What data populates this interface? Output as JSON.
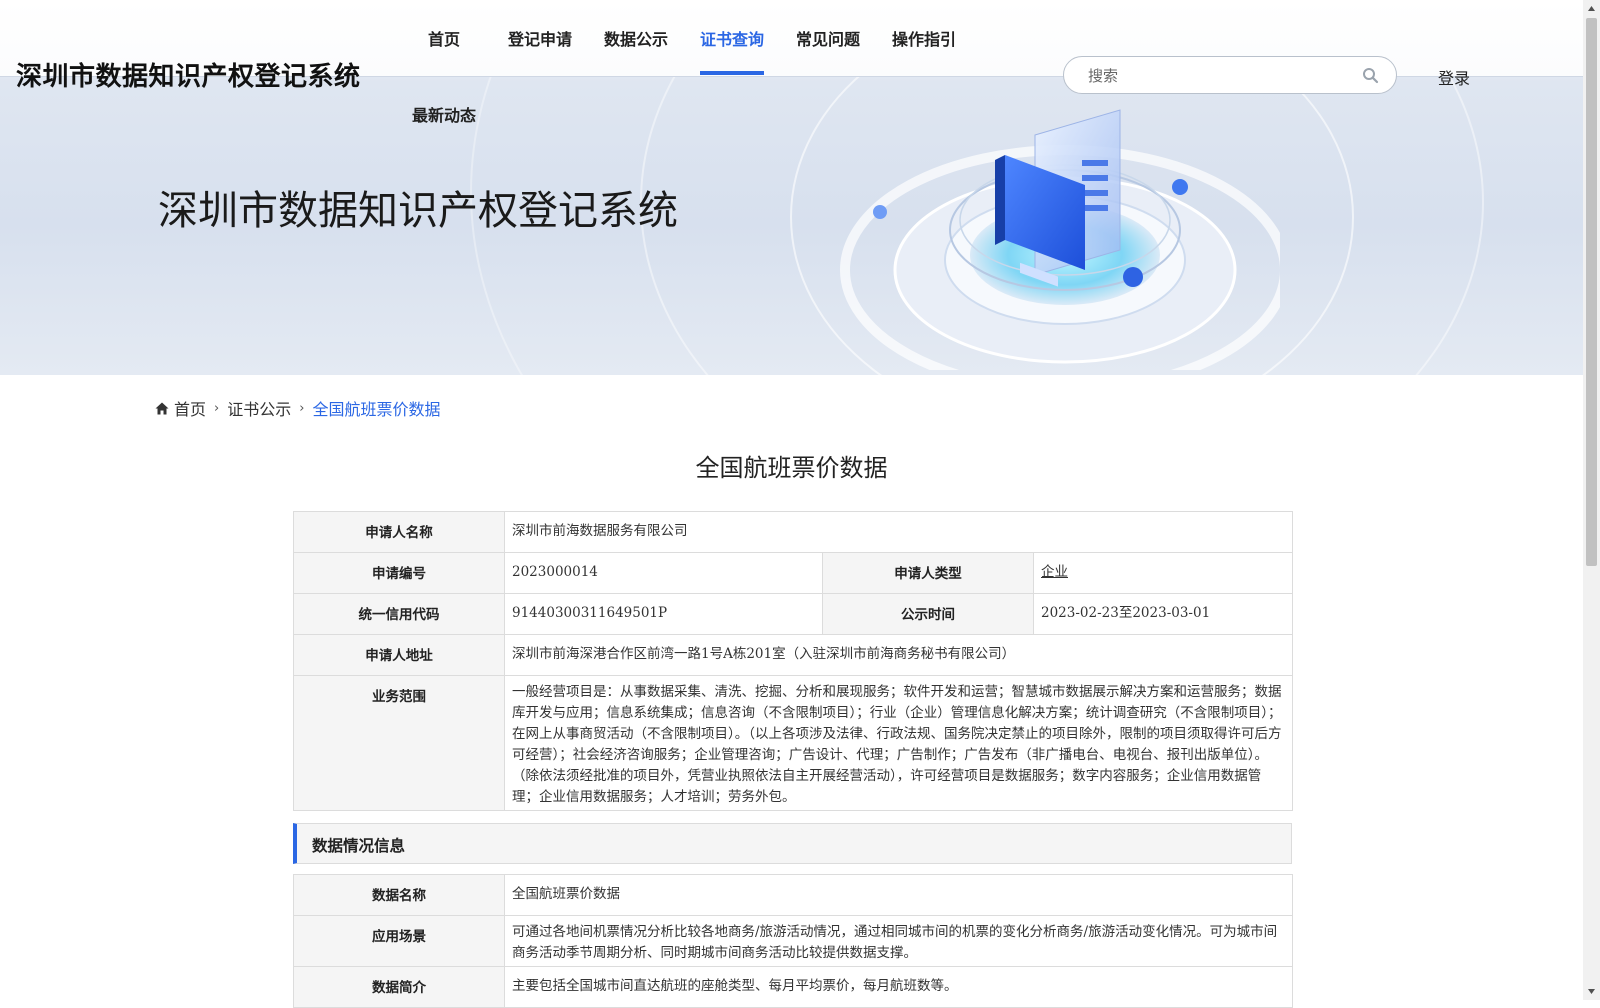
{
  "header": {
    "site_title": "深圳市数据知识产权登记系统",
    "nav": [
      {
        "label": "首页"
      },
      {
        "label": "登记申请"
      },
      {
        "label": "数据公示"
      },
      {
        "label": "证书查询",
        "active": true
      },
      {
        "label": "常见问题"
      },
      {
        "label": "操作指引"
      },
      {
        "label": "最新动态"
      }
    ],
    "search_placeholder": "搜索",
    "login_label": "登录"
  },
  "banner": {
    "heading": "深圳市数据知识产权登记系统"
  },
  "breadcrumb": {
    "home": "首页",
    "parent": "证书公示",
    "current": "全国航班票价数据"
  },
  "detail": {
    "title": "全国航班票价数据",
    "applicant_name_label": "申请人名称",
    "applicant_name": "深圳市前海数据服务有限公司",
    "application_no_label": "申请编号",
    "application_no": "2023000014",
    "applicant_type_label": "申请人类型",
    "applicant_type": "企业",
    "credit_code_label": "统一信用代码",
    "credit_code": "91440300311649501P",
    "publicity_time_label": "公示时间",
    "publicity_time": "2023-02-23至2023-03-01",
    "address_label": "申请人地址",
    "address": "深圳市前海深港合作区前湾一路1号A栋201室（入驻深圳市前海商务秘书有限公司）",
    "business_scope_label": "业务范围",
    "business_scope": "一般经营项目是：从事数据采集、清洗、挖掘、分析和展现服务；软件开发和运营；智慧城市数据展示解决方案和运营服务；数据库开发与应用；信息系统集成；信息咨询（不含限制项目）；行业（企业）管理信息化解决方案；统计调查研究（不含限制项目）；在网上从事商贸活动（不含限制项目）。（以上各项涉及法律、行政法规、国务院决定禁止的项目除外，限制的项目须取得许可后方可经营）；社会经济咨询服务；企业管理咨询；广告设计、代理；广告制作；广告发布（非广播电台、电视台、报刊出版单位）。（除依法须经批准的项目外，凭营业执照依法自主开展经营活动），许可经营项目是数据服务；数字内容服务；企业信用数据管理；企业信用数据服务；人才培训；劳务外包。"
  },
  "data_section": {
    "title": "数据情况信息",
    "data_name_label": "数据名称",
    "data_name": "全国航班票价数据",
    "scenario_label": "应用场景",
    "scenario": "可通过各地间机票情况分析比较各地商务/旅游活动情况，通过相同城市间的机票的变化分析商务/旅游活动变化情况。可为城市间商务活动季节周期分析、同时期城市间商务活动比较提供数据支撑。",
    "summary_label": "数据简介",
    "summary": "主要包括全国城市间直达航班的座舱类型、每月平均票价，每月航班数等。"
  },
  "colors": {
    "accent": "#2b67e4",
    "label_bg": "#f5f5f5",
    "border": "#dcdcdc"
  },
  "icons": [
    "home-icon",
    "search-icon",
    "chevron-right-icon",
    "scroll-up-arrow-icon",
    "scroll-down-arrow-icon",
    "certificate-illustration"
  ]
}
